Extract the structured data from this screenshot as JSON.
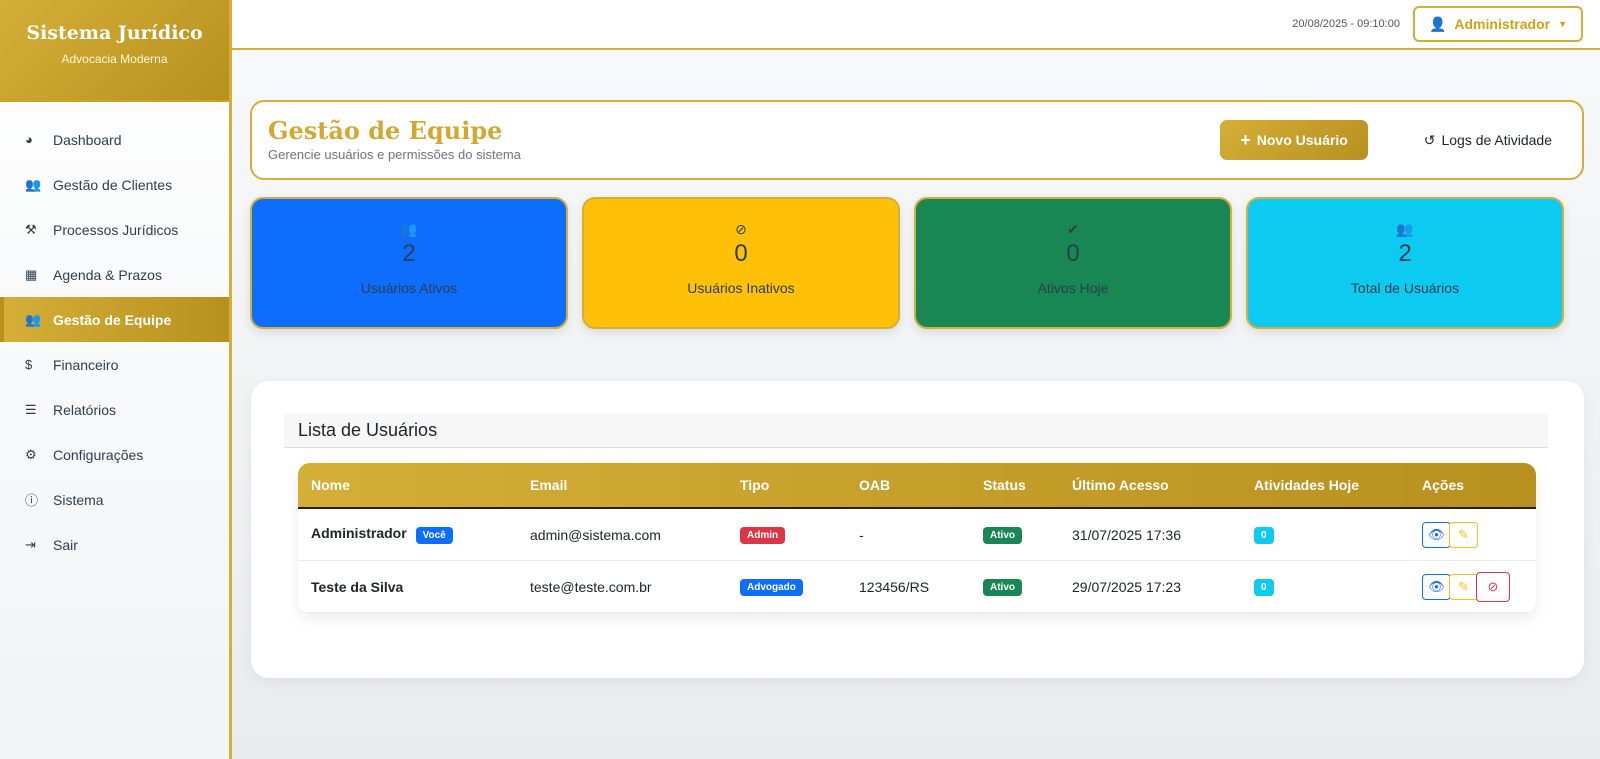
{
  "brand": {
    "title": "Sistema Jurídico",
    "subtitle": "Advocacia Moderna"
  },
  "nav": [
    {
      "label": "Dashboard",
      "icon": "gauge-icon",
      "glyph": "◕"
    },
    {
      "label": "Gestão de Clientes",
      "icon": "users-icon",
      "glyph": "👥"
    },
    {
      "label": "Processos Jurídicos",
      "icon": "gavel-icon",
      "glyph": "⚒"
    },
    {
      "label": "Agenda & Prazos",
      "icon": "calendar-icon",
      "glyph": "▦"
    },
    {
      "label": "Gestão de Equipe",
      "icon": "user-friends-icon",
      "glyph": "👥"
    },
    {
      "label": "Financeiro",
      "icon": "dollar-icon",
      "glyph": "$"
    },
    {
      "label": "Relatórios",
      "icon": "chart-icon",
      "glyph": "☰"
    },
    {
      "label": "Configurações",
      "icon": "gear-icon",
      "glyph": "⚙"
    },
    {
      "label": "Sistema",
      "icon": "info-icon",
      "glyph": "ⓘ"
    },
    {
      "label": "Sair",
      "icon": "sign-out-icon",
      "glyph": "⇥"
    }
  ],
  "topbar": {
    "datetime": "20/08/2025 - 09:10:00",
    "user": "Administrador"
  },
  "header": {
    "title": "Gestão de Equipe",
    "subtitle": "Gerencie usuários e permissões do sistema",
    "new_user": "Novo Usuário",
    "logs": "Logs de Atividade"
  },
  "stats": [
    {
      "value": "2",
      "label": "Usuários Ativos",
      "color": "#0d6efd",
      "glyph": "👥"
    },
    {
      "value": "0",
      "label": "Usuários Inativos",
      "color": "#ffc107",
      "glyph": "⊘"
    },
    {
      "value": "0",
      "label": "Ativos Hoje",
      "color": "#198754",
      "glyph": "✔"
    },
    {
      "value": "2",
      "label": "Total de Usuários",
      "color": "#0dcaf0",
      "glyph": "👥"
    }
  ],
  "list": {
    "title": "Lista de Usuários",
    "columns": [
      "Nome",
      "Email",
      "Tipo",
      "OAB",
      "Status",
      "Último Acesso",
      "Atividades Hoje",
      "Ações"
    ],
    "rows": [
      {
        "name": "Administrador",
        "you": "Você",
        "email": "admin@sistema.com",
        "type": "Admin",
        "oab": "-",
        "status": "Ativo",
        "last": "31/07/2025 17:36",
        "activities": "0"
      },
      {
        "name": "Teste da Silva",
        "email": "teste@teste.com.br",
        "type": "Advogado",
        "oab": "123456/RS",
        "status": "Ativo",
        "last": "29/07/2025 17:23",
        "activities": "0"
      }
    ]
  }
}
